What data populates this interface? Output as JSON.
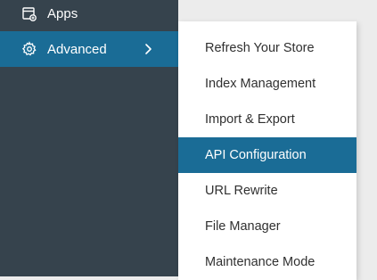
{
  "sidebar": {
    "items": [
      {
        "label": "Apps",
        "icon": "apps-icon"
      },
      {
        "label": "Advanced",
        "icon": "gear-icon",
        "selected": true,
        "expand_icon": "chevron-right-icon"
      }
    ]
  },
  "submenu": {
    "items": [
      {
        "label": "Refresh Your Store"
      },
      {
        "label": "Index Management"
      },
      {
        "label": "Import & Export"
      },
      {
        "label": "API Configuration",
        "active": true
      },
      {
        "label": "URL Rewrite"
      },
      {
        "label": "File Manager"
      },
      {
        "label": "Maintenance Mode"
      }
    ]
  },
  "colors": {
    "sidebar_bg": "#36434d",
    "accent": "#1a6c96",
    "page_bg": "#ececec",
    "submenu_bg": "#ffffff",
    "submenu_text": "#303030"
  }
}
